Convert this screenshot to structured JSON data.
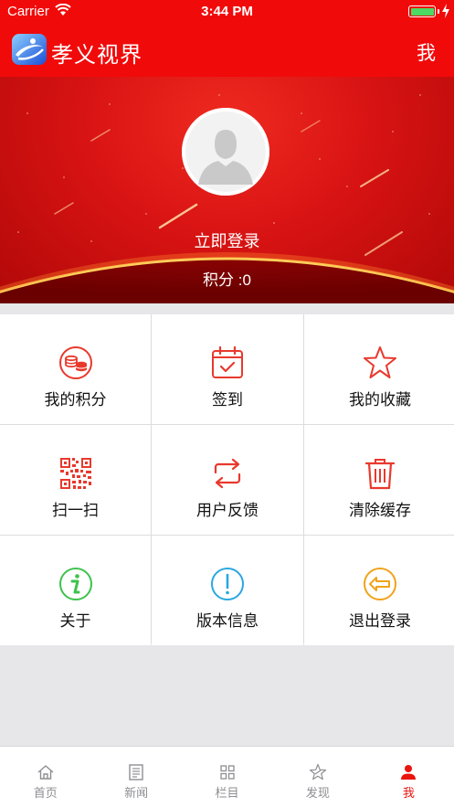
{
  "status_bar": {
    "carrier": "Carrier",
    "time": "3:44 PM",
    "battery_level": 1.0
  },
  "nav": {
    "title": "孝义视界",
    "right_label": "我"
  },
  "profile": {
    "login_label": "立即登录",
    "points_label": "积分 :0"
  },
  "menu": [
    {
      "label": "我的积分",
      "icon": "coins-icon"
    },
    {
      "label": "签到",
      "icon": "calendar-check-icon"
    },
    {
      "label": "我的收藏",
      "icon": "star-icon"
    },
    {
      "label": "扫一扫",
      "icon": "qr-code-icon"
    },
    {
      "label": "用户反馈",
      "icon": "swap-arrows-icon"
    },
    {
      "label": "清除缓存",
      "icon": "trash-icon"
    },
    {
      "label": "关于",
      "icon": "info-icon"
    },
    {
      "label": "版本信息",
      "icon": "exclamation-icon"
    },
    {
      "label": "退出登录",
      "icon": "logout-arrow-icon"
    }
  ],
  "tabs": [
    {
      "label": "首页",
      "icon": "home-icon",
      "active": false
    },
    {
      "label": "新闻",
      "icon": "news-icon",
      "active": false
    },
    {
      "label": "栏目",
      "icon": "grid-icon",
      "active": false
    },
    {
      "label": "发现",
      "icon": "discover-star-icon",
      "active": false
    },
    {
      "label": "我",
      "icon": "person-icon",
      "active": true
    }
  ],
  "colors": {
    "brand_red": "#f10a0a",
    "active_tab": "#e9150e",
    "icon_red": "#e8392d",
    "icon_green": "#3ec24e",
    "icon_blue": "#2aa8e0",
    "icon_orange": "#f2a21b"
  }
}
